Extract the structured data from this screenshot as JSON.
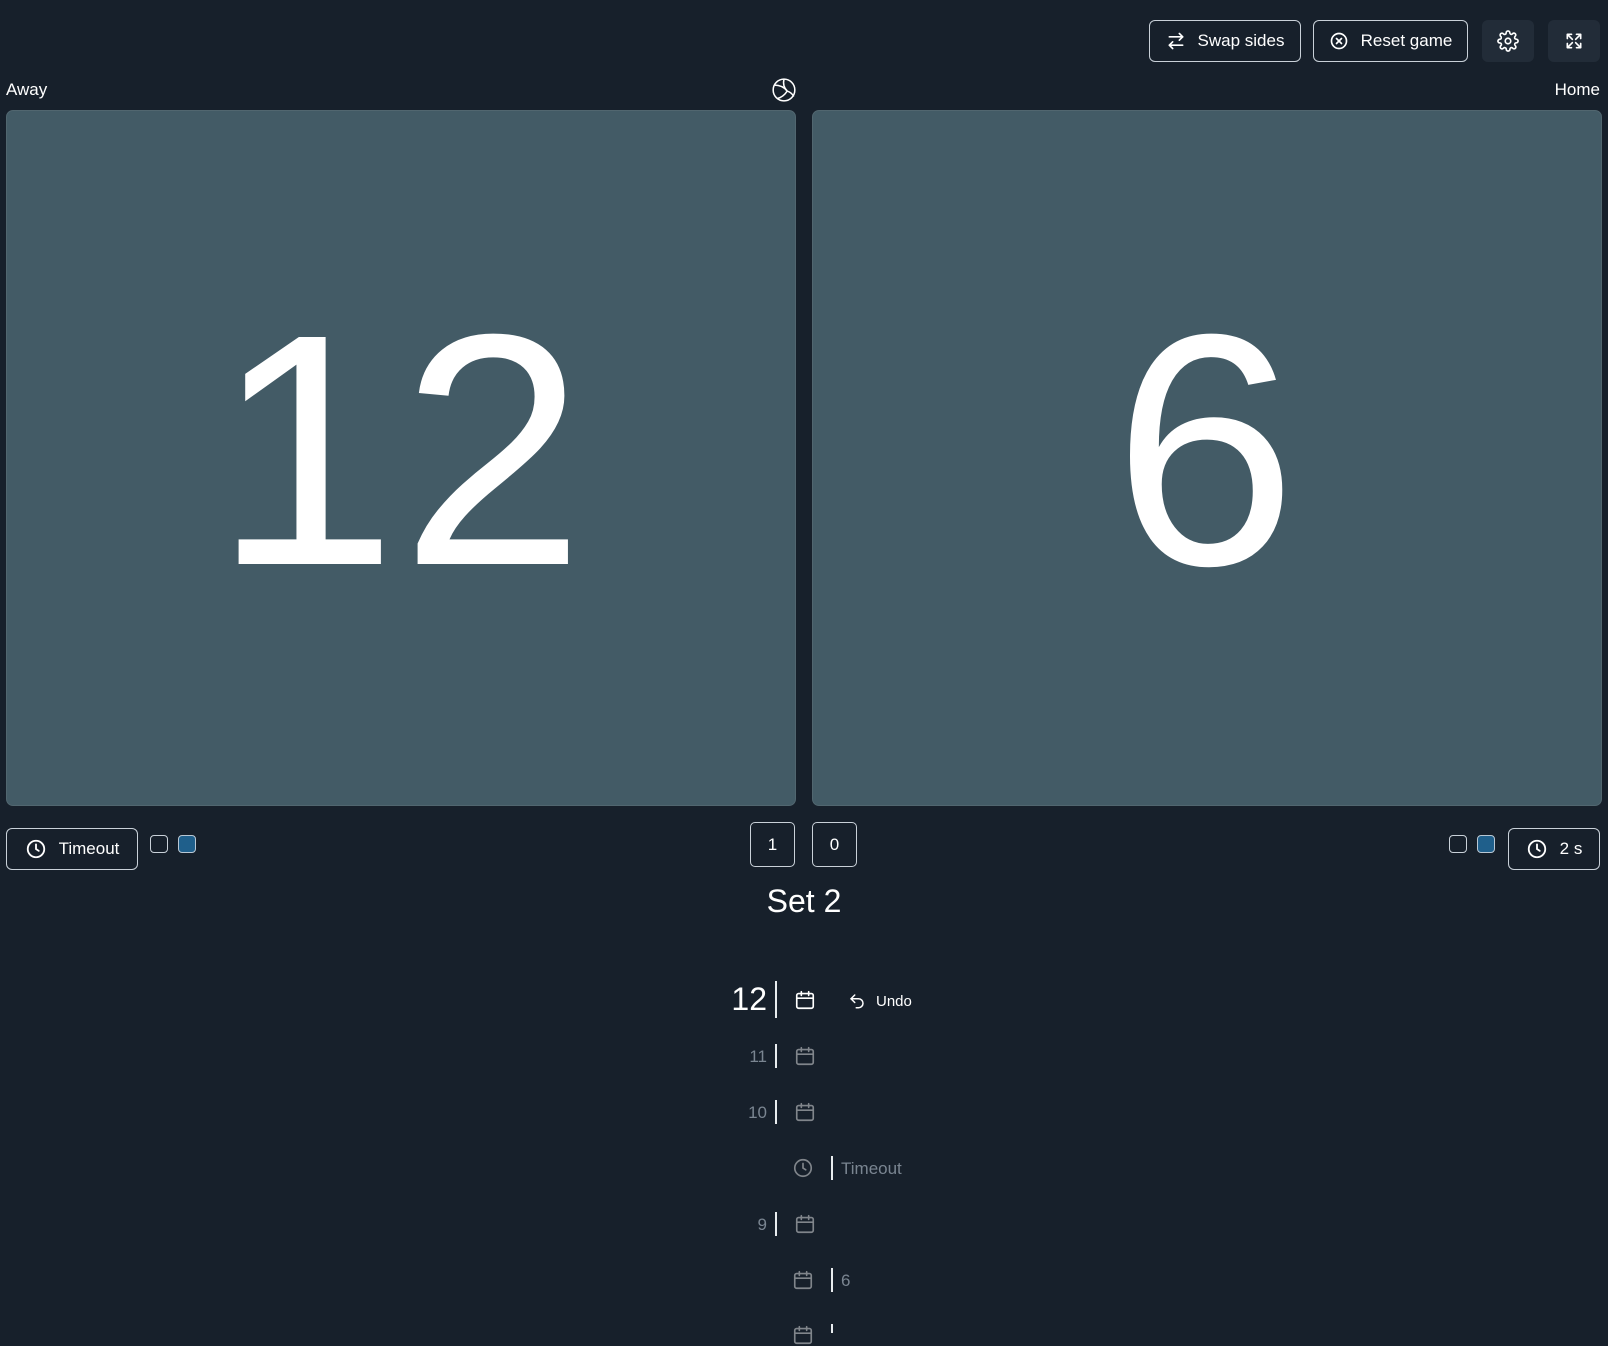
{
  "toolbar": {
    "swap_label": "Swap sides",
    "reset_label": "Reset game"
  },
  "teams": {
    "left": {
      "name": "Away",
      "score": "12",
      "timeout_label": "Timeout"
    },
    "right": {
      "name": "Home",
      "score": "6",
      "timeout_label": "2 s"
    }
  },
  "sets_won": {
    "left": "1",
    "right": "0"
  },
  "set_title": "Set 2",
  "history": {
    "current_score": "12",
    "undo_label": "Undo",
    "entries": [
      {
        "score": "11"
      },
      {
        "score": "10"
      },
      {
        "label": "Timeout"
      },
      {
        "score": "9"
      },
      {
        "label": "6"
      }
    ]
  },
  "colors": {
    "background": "#17202b",
    "panel": "#435b66",
    "checkbox_fill": "#1f5f8b",
    "muted_text": "#7a8591"
  }
}
